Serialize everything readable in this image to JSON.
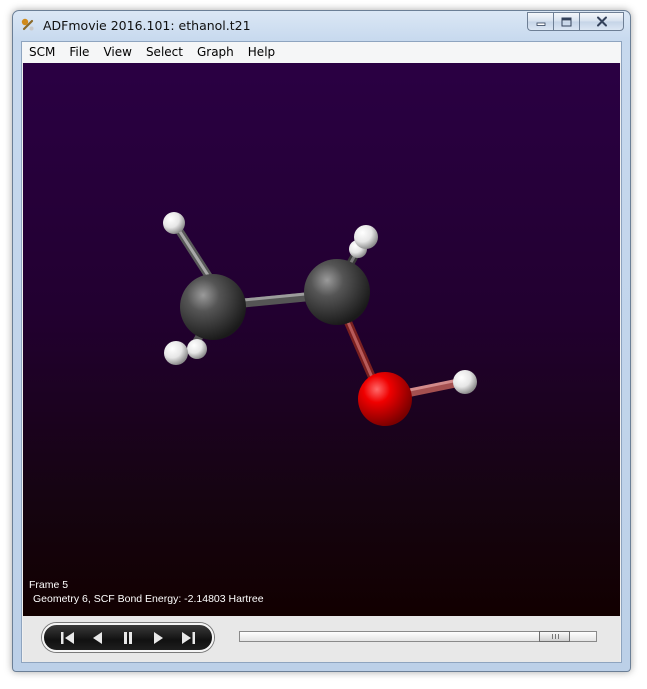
{
  "window": {
    "title": "ADFmovie 2016.101: ethanol.t21"
  },
  "menu": {
    "items": [
      {
        "label": "SCM",
        "name": "menu-scm"
      },
      {
        "label": "File",
        "name": "menu-file"
      },
      {
        "label": "View",
        "name": "menu-view"
      },
      {
        "label": "Select",
        "name": "menu-select"
      },
      {
        "label": "Graph",
        "name": "menu-graph"
      },
      {
        "label": "Help",
        "name": "menu-help"
      }
    ]
  },
  "viewport": {
    "frame_label": "Frame 5",
    "geometry_label": "Geometry 6, SCF Bond Energy: -2.14803 Hartree",
    "background_top": "#2a0043",
    "background_bottom": "#120000",
    "molecule": "ethanol",
    "atom_colors": {
      "carbon": "#3c3c3c",
      "hydrogen": "#f4f4f4",
      "oxygen": "#e00000"
    }
  },
  "controls": {
    "transport_icons": [
      "first-frame-icon",
      "step-back-icon",
      "pause-icon",
      "play-icon",
      "last-frame-icon"
    ],
    "slider_position": 0.92
  }
}
